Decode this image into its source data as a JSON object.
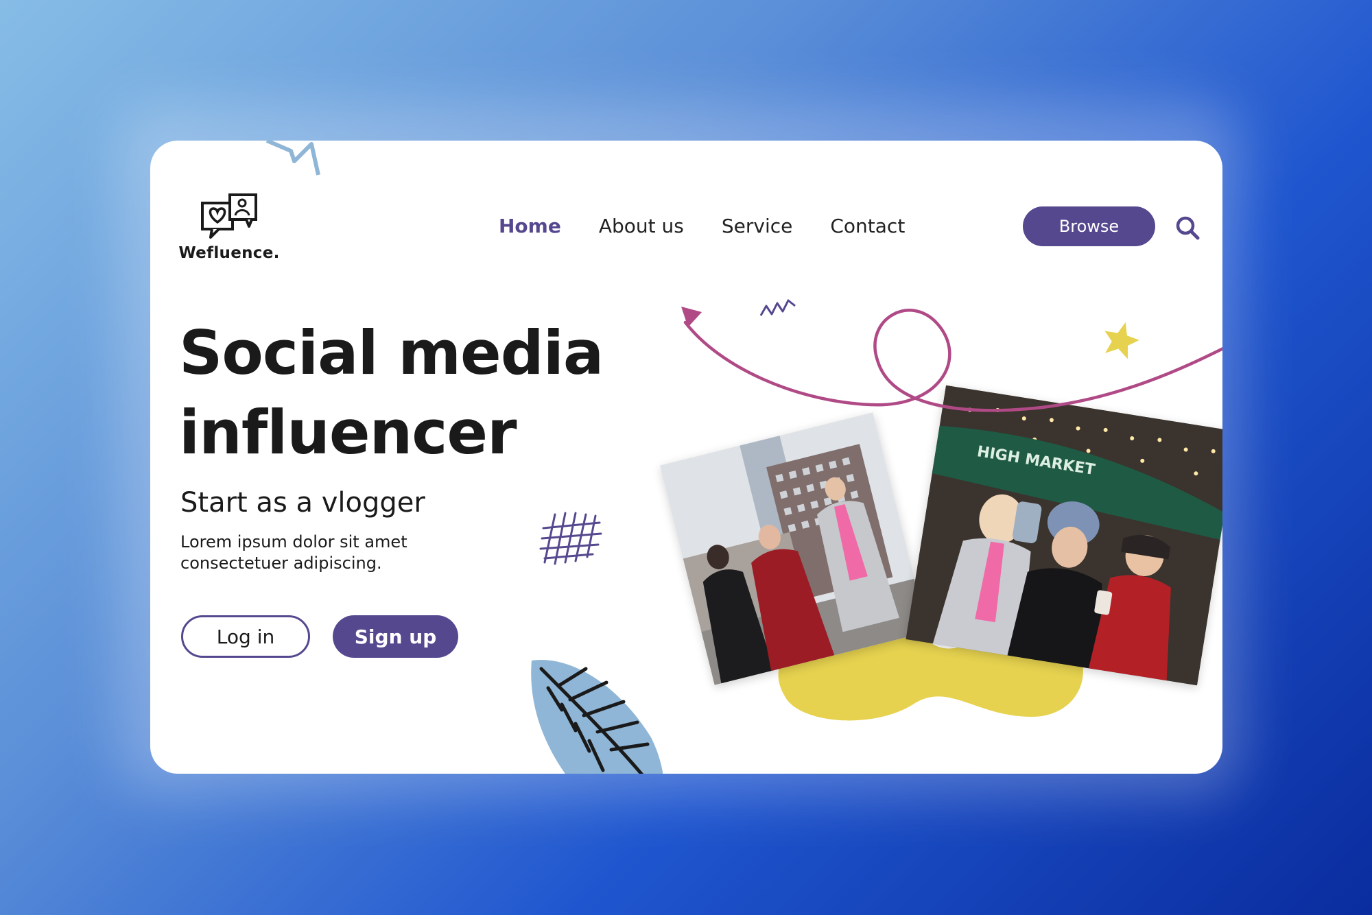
{
  "brand": {
    "name": "Wefluence."
  },
  "nav": {
    "items": [
      {
        "label": "Home",
        "active": true
      },
      {
        "label": "About us",
        "active": false
      },
      {
        "label": "Service",
        "active": false
      },
      {
        "label": "Contact",
        "active": false
      }
    ],
    "browse_label": "Browse"
  },
  "hero": {
    "title_line1": "Social media",
    "title_line2": "influencer",
    "subtitle": "Start as a vlogger",
    "description": "Lorem ipsum dolor sit amet consectetuer adipiscing.",
    "login_label": "Log in",
    "signup_label": "Sign up"
  },
  "photos": {
    "left_scene": "women taking selfies on city street",
    "right_sign": "HIGH MARKET"
  },
  "colors": {
    "accent": "#56488f",
    "text": "#1a1a1a",
    "yellow": "#e6d24f",
    "leaf": "#8fb6d6",
    "arrow": "#b04a86"
  },
  "icons": {
    "logo": "chat-heart-person-icon",
    "search": "search-icon"
  }
}
